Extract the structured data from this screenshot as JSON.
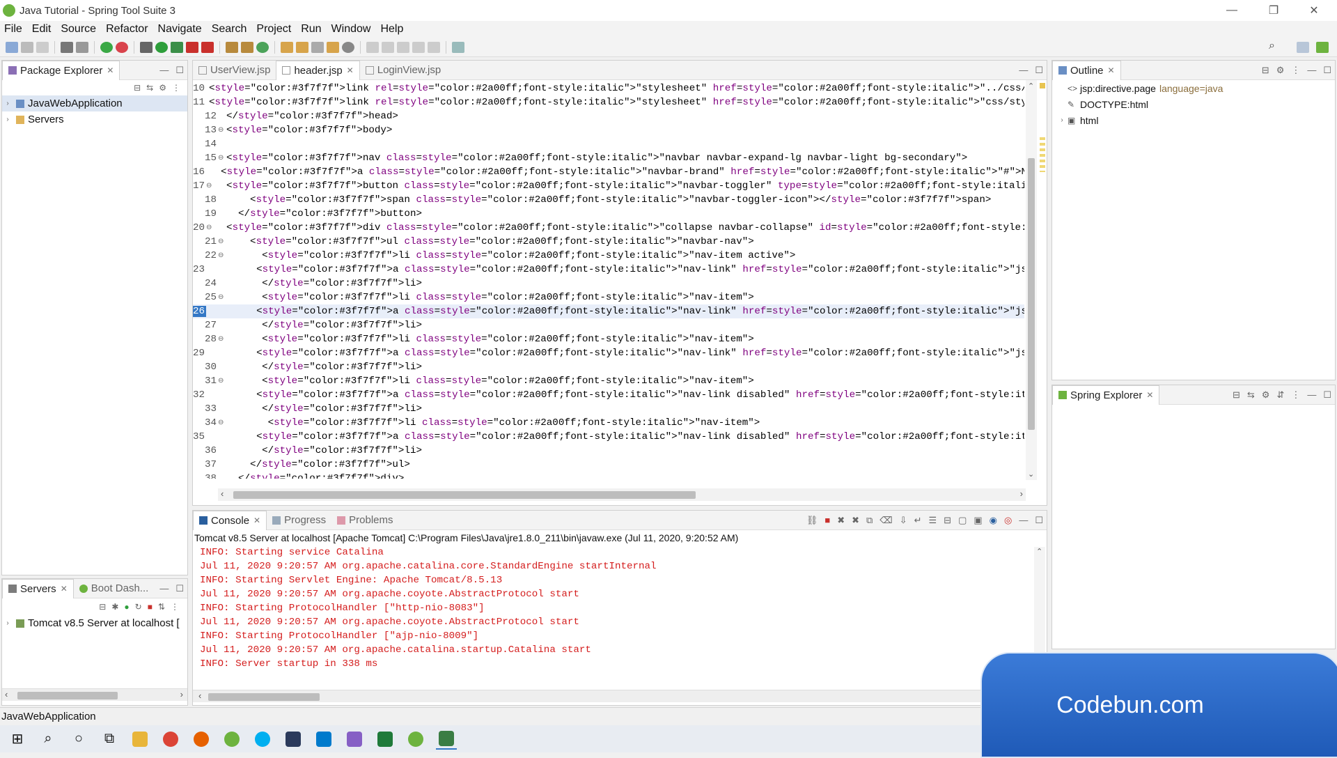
{
  "window": {
    "title": "Java Tutorial - Spring Tool Suite 3"
  },
  "menubar": [
    "File",
    "Edit",
    "Source",
    "Refactor",
    "Navigate",
    "Search",
    "Project",
    "Run",
    "Window",
    "Help"
  ],
  "package_explorer": {
    "tab_label": "Package Explorer",
    "items": [
      {
        "label": "JavaWebApplication",
        "icon": "project-icon"
      },
      {
        "label": "Servers",
        "icon": "folder-icon"
      }
    ]
  },
  "servers_view": {
    "tab_label": "Servers",
    "tab2_label": "Boot Dash...",
    "items": [
      {
        "label": "Tomcat v8.5 Server at localhost  ["
      }
    ]
  },
  "editor": {
    "tabs": [
      {
        "label": "UserView.jsp",
        "active": false
      },
      {
        "label": "header.jsp",
        "active": true
      },
      {
        "label": "LoginView.jsp",
        "active": false
      }
    ],
    "lines": [
      {
        "n": "10",
        "fold": "",
        "text": "<link rel=\"stylesheet\" href=\"../css/style.css\">"
      },
      {
        "n": "11",
        "fold": "",
        "text": "<link rel=\"stylesheet\" href=\"css/style.css\">"
      },
      {
        "n": "12",
        "fold": "",
        "text": "</head>"
      },
      {
        "n": "13",
        "fold": "⊖",
        "text": "<body>"
      },
      {
        "n": "14",
        "fold": "",
        "text": ""
      },
      {
        "n": "15",
        "fold": "⊖",
        "text": "<nav class=\"navbar navbar-expand-lg navbar-light bg-secondary\">"
      },
      {
        "n": "16",
        "fold": "",
        "text": "  <a class=\"navbar-brand\" href=\"#\">Navbar</a>"
      },
      {
        "n": "17",
        "fold": "⊖",
        "text": "  <button class=\"navbar-toggler\" type=\"button\" data-toggle=\"collapse\" data-target=\"#navbarNav\" aria-controls=\"navbarNav\" aria-ex"
      },
      {
        "n": "18",
        "fold": "",
        "text": "    <span class=\"navbar-toggler-icon\"></span>"
      },
      {
        "n": "19",
        "fold": "",
        "text": "  </button>"
      },
      {
        "n": "20",
        "fold": "⊖",
        "text": "  <div class=\"collapse navbar-collapse\" id=\"navbarNav\">"
      },
      {
        "n": "21",
        "fold": "⊖",
        "text": "    <ul class=\"navbar-nav\">"
      },
      {
        "n": "22",
        "fold": "⊖",
        "text": "      <li class=\"nav-item active\">"
      },
      {
        "n": "23",
        "fold": "",
        "text": "        <a class=\"nav-link\" href=\"jsp/home.jsp\">Home <span class=\"sr-only\">(current)</span></a>"
      },
      {
        "n": "24",
        "fold": "",
        "text": "      </li>"
      },
      {
        "n": "25",
        "fold": "⊖",
        "text": "      <li class=\"nav-item\">"
      },
      {
        "n": "26",
        "fold": "",
        "text": "        <a class=\"nav-link\" href=\"jsp/LoginView.jsp\">Login</a>"
      },
      {
        "n": "27",
        "fold": "",
        "text": "      </li>"
      },
      {
        "n": "28",
        "fold": "⊖",
        "text": "      <li class=\"nav-item\">"
      },
      {
        "n": "29",
        "fold": "",
        "text": "        <a class=\"nav-link\" href=\"jsp/UserView.jsp\">Registration</a>"
      },
      {
        "n": "30",
        "fold": "",
        "text": "      </li>"
      },
      {
        "n": "31",
        "fold": "⊖",
        "text": "      <li class=\"nav-item\">"
      },
      {
        "n": "32",
        "fold": "",
        "text": "        <a class=\"nav-link disabled\" href=\"#\">ContactUS</a>"
      },
      {
        "n": "33",
        "fold": "",
        "text": "      </li>"
      },
      {
        "n": "34",
        "fold": "⊖",
        "text": "       <li class=\"nav-item\">"
      },
      {
        "n": "35",
        "fold": "",
        "text": "        <a class=\"nav-link disabled\" href=\"#\">AboutUS</a>"
      },
      {
        "n": "36",
        "fold": "",
        "text": "      </li>"
      },
      {
        "n": "37",
        "fold": "",
        "text": "    </ul>"
      },
      {
        "n": "38",
        "fold": "",
        "text": "  </div>"
      }
    ],
    "current_line": "26"
  },
  "outline": {
    "tab_label": "Outline",
    "items": [
      {
        "label": "jsp:directive.page",
        "suffix": "language=java"
      },
      {
        "label": "DOCTYPE:html",
        "suffix": ""
      },
      {
        "label": "html",
        "suffix": ""
      }
    ]
  },
  "spring_explorer": {
    "tab_label": "Spring Explorer"
  },
  "console": {
    "tabs": [
      "Console",
      "Progress",
      "Problems"
    ],
    "header": "Tomcat v8.5 Server at localhost [Apache Tomcat] C:\\Program Files\\Java\\jre1.8.0_211\\bin\\javaw.exe  (Jul 11, 2020, 9:20:52 AM)",
    "lines": [
      "INFO: Starting service Catalina",
      "Jul 11, 2020 9:20:57 AM org.apache.catalina.core.StandardEngine startInternal",
      "INFO: Starting Servlet Engine: Apache Tomcat/8.5.13",
      "Jul 11, 2020 9:20:57 AM org.apache.coyote.AbstractProtocol start",
      "INFO: Starting ProtocolHandler [\"http-nio-8083\"]",
      "Jul 11, 2020 9:20:57 AM org.apache.coyote.AbstractProtocol start",
      "INFO: Starting ProtocolHandler [\"ajp-nio-8009\"]",
      "Jul 11, 2020 9:20:57 AM org.apache.catalina.startup.Catalina start",
      "INFO: Server startup in 338 ms"
    ]
  },
  "statusbar": {
    "text": "JavaWebApplication"
  },
  "watermark": {
    "text": "Codebun.com"
  },
  "colors": {
    "console_text": "#d41d1d",
    "string_literal": "#2a00ff",
    "tag": "#3f7f7f",
    "attr": "#7f007f",
    "selection": "#3478c6"
  }
}
